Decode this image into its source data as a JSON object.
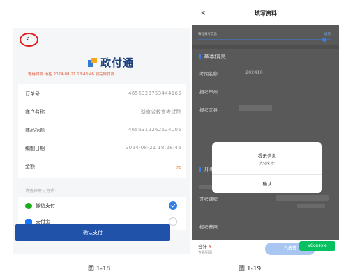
{
  "figure_left": {
    "caption": "图 1-18",
    "back_glyph": "‹",
    "brand": "政付通",
    "countdown": "等待付款 请在 2024-08-21 18:48:46 前完成付款",
    "rows": [
      {
        "label": "订单号",
        "value": "4656323753444165"
      },
      {
        "label": "商户名称",
        "value": "湖南省教育考试院"
      },
      {
        "label": "商品标题",
        "value": "4656312262624005"
      },
      {
        "label": "编制日期",
        "value": "2024-08-21 18:28:46"
      },
      {
        "label": "金额",
        "value": "元"
      }
    ],
    "method_title": "请选择支付方式:",
    "methods": [
      {
        "label": "微信支付",
        "selected": true,
        "icon": "wechat-icon"
      },
      {
        "label": "支付宝",
        "selected": false,
        "icon": "alipay-icon"
      }
    ],
    "confirm_label": "确认支付",
    "colors": {
      "primary": "#1f52a8",
      "accent": "#f08a3a",
      "wechat": "#1aad19",
      "alipay": "#1677ff"
    }
  },
  "figure_right": {
    "caption": "图 1-19",
    "back_glyph": "<",
    "title": "填写资料",
    "step_left": "填写报考信息",
    "step_right": "缴费",
    "section_basic": "基本信息",
    "rows": [
      {
        "label": "考期名称",
        "value": "202410"
      },
      {
        "label": "报考市州",
        "value": ""
      },
      {
        "label": "报考区县",
        "value": ""
      }
    ],
    "section_course": "开考课程",
    "course_label": "开考课程",
    "fee_label": "报考费用",
    "dialog": {
      "title": "提示信息",
      "message": "支付成功!",
      "button": "确认"
    },
    "footer": {
      "total_label": "合计",
      "currency": "¥",
      "detail": "查看明细",
      "submit": "已缴费"
    },
    "vconsole": "vConsole"
  }
}
